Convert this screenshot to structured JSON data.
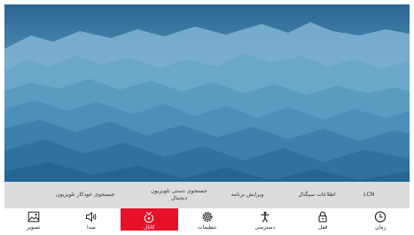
{
  "submenu": {
    "items": [
      {
        "id": "lcn",
        "label": "LCN"
      },
      {
        "id": "signal",
        "label": "اطلاعات سیگنال"
      },
      {
        "id": "edit",
        "label": "ویرایش برنامه"
      },
      {
        "id": "manual",
        "label": "جستجوی دستی تلویزیون\nدیجیتال"
      },
      {
        "id": "auto",
        "label": "جستجوی خودکار تلویزیون"
      }
    ]
  },
  "menu": {
    "items": [
      {
        "id": "time",
        "label": "زمان",
        "icon": "clock-icon"
      },
      {
        "id": "lock",
        "label": "قفل",
        "icon": "lock-icon"
      },
      {
        "id": "accessibility",
        "label": "دسترسی",
        "icon": "accessibility-icon"
      },
      {
        "id": "settings",
        "label": "تنظیمات",
        "icon": "gear-icon"
      },
      {
        "id": "channel",
        "label": "کانال",
        "icon": "channel-icon",
        "active": true
      },
      {
        "id": "sound",
        "label": "صدا",
        "icon": "speaker-icon"
      },
      {
        "id": "picture",
        "label": "تصویر",
        "icon": "picture-icon"
      }
    ]
  },
  "colors": {
    "active": "#e8112a",
    "submenu_bg": "#dcdcdc",
    "sky_top": "#2b6a95",
    "sky_bottom": "#a9cfe3"
  }
}
